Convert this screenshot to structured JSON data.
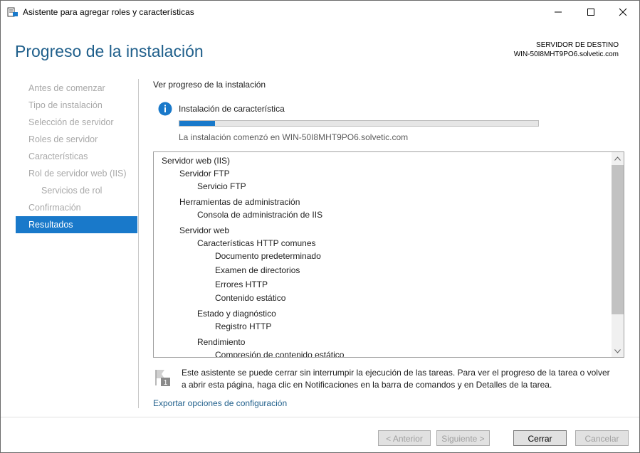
{
  "window": {
    "title": "Asistente para agregar roles y características"
  },
  "header": {
    "title": "Progreso de la instalación",
    "dest_label": "SERVIDOR DE DESTINO",
    "dest_value": "WIN-50I8MHT9PO6.solvetic.com"
  },
  "nav": {
    "items": [
      {
        "label": "Antes de comenzar",
        "active": false,
        "sub": false
      },
      {
        "label": "Tipo de instalación",
        "active": false,
        "sub": false
      },
      {
        "label": "Selección de servidor",
        "active": false,
        "sub": false
      },
      {
        "label": "Roles de servidor",
        "active": false,
        "sub": false
      },
      {
        "label": "Características",
        "active": false,
        "sub": false
      },
      {
        "label": "Rol de servidor web (IIS)",
        "active": false,
        "sub": false
      },
      {
        "label": "Servicios de rol",
        "active": false,
        "sub": true
      },
      {
        "label": "Confirmación",
        "active": false,
        "sub": false
      },
      {
        "label": "Resultados",
        "active": true,
        "sub": false
      }
    ]
  },
  "content": {
    "section_title": "Ver progreso de la instalación",
    "status": "Instalación de característica",
    "progress_fraction": 0.1,
    "started": "La instalación comenzó en WIN-50I8MHT9PO6.solvetic.com",
    "results": [
      {
        "text": "Servidor web (IIS)",
        "level": 0
      },
      {
        "text": "Servidor FTP",
        "level": 1
      },
      {
        "text": "Servicio FTP",
        "level": 2
      },
      {
        "text": "Herramientas de administración",
        "level": 1
      },
      {
        "text": "Consola de administración de IIS",
        "level": 2
      },
      {
        "text": "Servidor web",
        "level": 1
      },
      {
        "text": "Características HTTP comunes",
        "level": 2
      },
      {
        "text": "Documento predeterminado",
        "level": 3
      },
      {
        "text": "Examen de directorios",
        "level": 3
      },
      {
        "text": "Errores HTTP",
        "level": 3
      },
      {
        "text": "Contenido estático",
        "level": 3
      },
      {
        "text": "Estado y diagnóstico",
        "level": 2
      },
      {
        "text": "Registro HTTP",
        "level": 3
      },
      {
        "text": "Rendimiento",
        "level": 2
      },
      {
        "text": "Compresión de contenido estático",
        "level": 3
      }
    ],
    "notice": "Este asistente se puede cerrar sin interrumpir la ejecución de las tareas. Para ver el progreso de la tarea o volver a abrir esta página, haga clic en Notificaciones en la barra de comandos y en Detalles de la tarea.",
    "notice_badge": "1",
    "export_link": "Exportar opciones de configuración"
  },
  "footer": {
    "prev": "< Anterior",
    "next": "Siguiente >",
    "close": "Cerrar",
    "cancel": "Cancelar"
  },
  "colors": {
    "accent": "#1979ca",
    "title": "#1f5f8b"
  }
}
